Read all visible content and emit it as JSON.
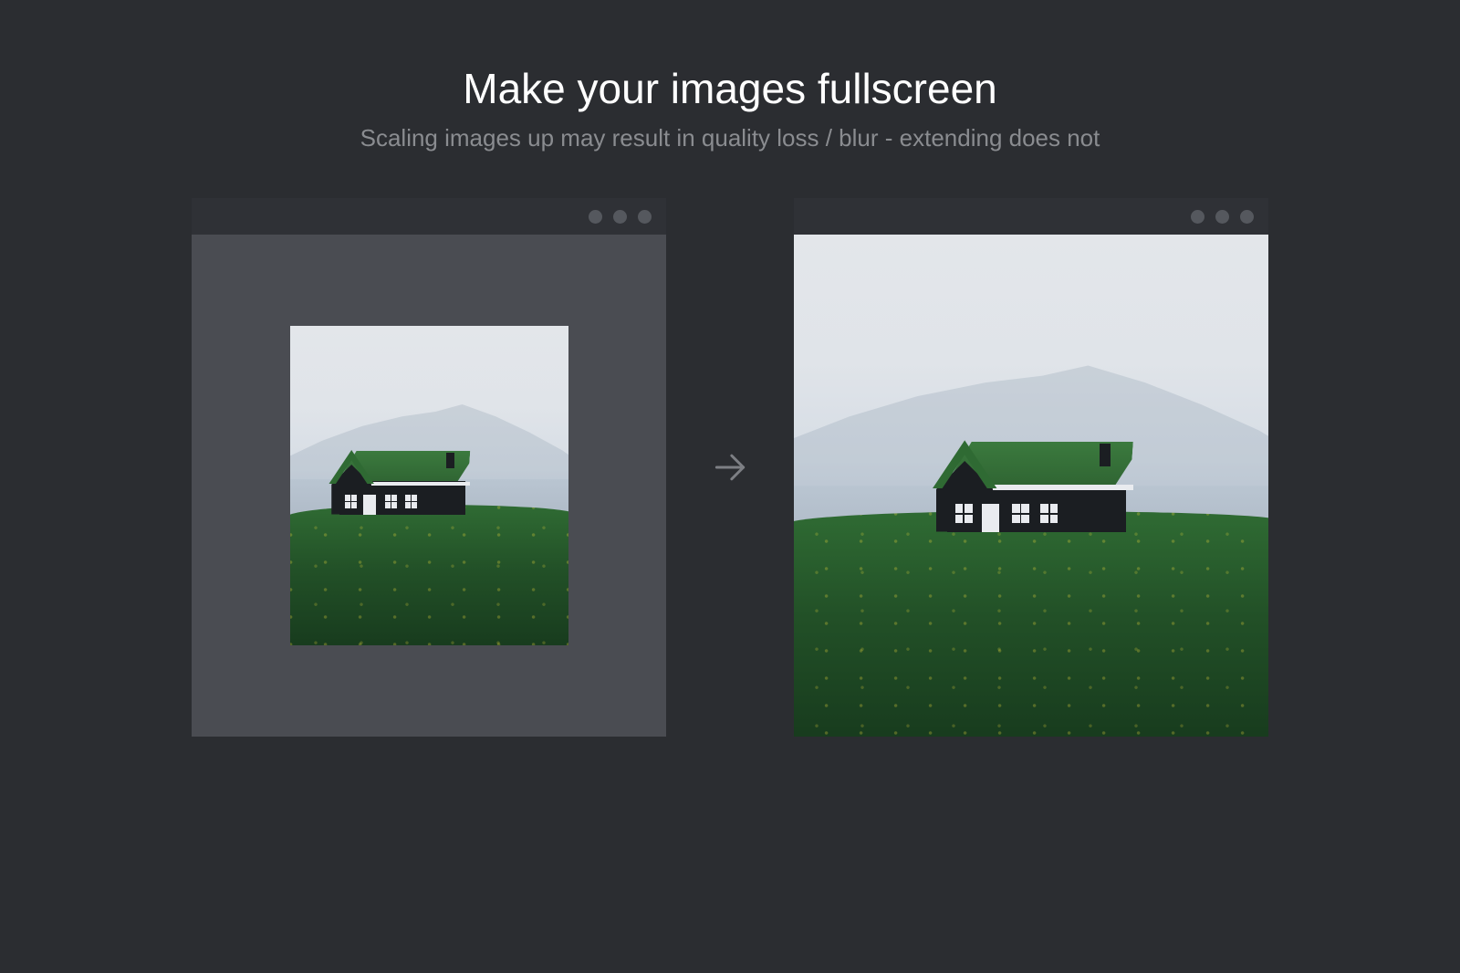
{
  "header": {
    "title": "Make your images fullscreen",
    "subtitle": "Scaling images up may result in quality loss / blur - extending does not"
  },
  "comparison": {
    "arrow_label": "→",
    "before_alt": "Original image with letterboxing",
    "after_alt": "Extended fullscreen image"
  }
}
